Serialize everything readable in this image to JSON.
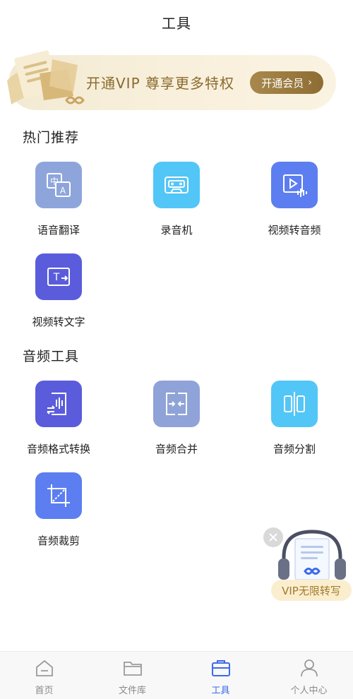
{
  "header": {
    "title": "工具"
  },
  "vip_banner": {
    "promo_text": "开通VIP 尊享更多特权",
    "cta_label": "开通会员"
  },
  "sections": [
    {
      "title": "热门推荐",
      "tools": [
        {
          "label": "语音翻译",
          "icon": "translate-icon",
          "color": "#8ea5dc"
        },
        {
          "label": "录音机",
          "icon": "cassette-icon",
          "color": "#52c6f7"
        },
        {
          "label": "视频转音频",
          "icon": "video-to-audio-icon",
          "color": "#5c7ef0"
        },
        {
          "label": "视频转文字",
          "icon": "video-to-text-icon",
          "color": "#5a5cdc"
        }
      ]
    },
    {
      "title": "音频工具",
      "tools": [
        {
          "label": "音频格式转换",
          "icon": "audio-convert-icon",
          "color": "#5a5cdc"
        },
        {
          "label": "音频合并",
          "icon": "audio-merge-icon",
          "color": "#8fa3d8"
        },
        {
          "label": "音频分割",
          "icon": "audio-split-icon",
          "color": "#52c6f7"
        },
        {
          "label": "音频裁剪",
          "icon": "crop-icon",
          "color": "#5c7ef0"
        }
      ]
    }
  ],
  "floating_widget": {
    "badge_text": "VIP无限转写"
  },
  "bottom_nav": {
    "active_index": 2,
    "items": [
      {
        "label": "首页",
        "icon": "home-icon"
      },
      {
        "label": "文件库",
        "icon": "folder-icon"
      },
      {
        "label": "工具",
        "icon": "toolbox-icon"
      },
      {
        "label": "个人中心",
        "icon": "person-icon"
      }
    ]
  }
}
